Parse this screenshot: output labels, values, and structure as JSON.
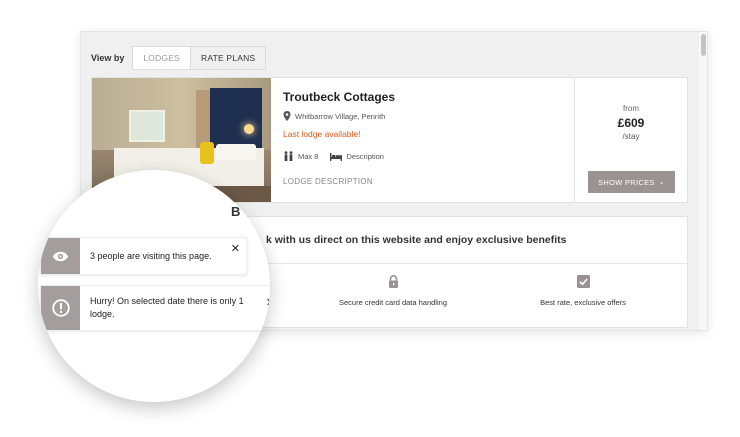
{
  "view_by": {
    "label": "View by",
    "tabs": [
      {
        "label": "LODGES",
        "active": false
      },
      {
        "label": "RATE PLANS",
        "active": true
      }
    ]
  },
  "lodge": {
    "title": "Troutbeck Cottages",
    "location": "Whitbarrow Village, Penrith",
    "alert": "Last lodge available!",
    "max_guests": "Max 8",
    "description_label": "Description",
    "description_link": "LODGE DESCRIPTION",
    "price_from": "from",
    "price": "£609",
    "price_unit": "/stay",
    "show_prices_label": "SHOW PRICES",
    "alert_color": "#e05a18"
  },
  "benefits": {
    "heading_visible": "k with us direct on this website and enjoy exclusive benefits",
    "partial_letter": "B",
    "items": [
      {
        "label": "Secure credit card data handling",
        "icon": "lock-icon"
      },
      {
        "label": "Best rate, exclusive offers",
        "icon": "checkbox-icon"
      }
    ]
  },
  "notifications": [
    {
      "text": "3 people are visiting this page.",
      "icon": "eye-icon"
    },
    {
      "text": "Hurry! On selected date there is only 1 lodge.",
      "icon": "alert-circle-icon"
    }
  ],
  "colors": {
    "button_bg": "#9a9391",
    "toast_icon_bg": "#a39d9b"
  }
}
